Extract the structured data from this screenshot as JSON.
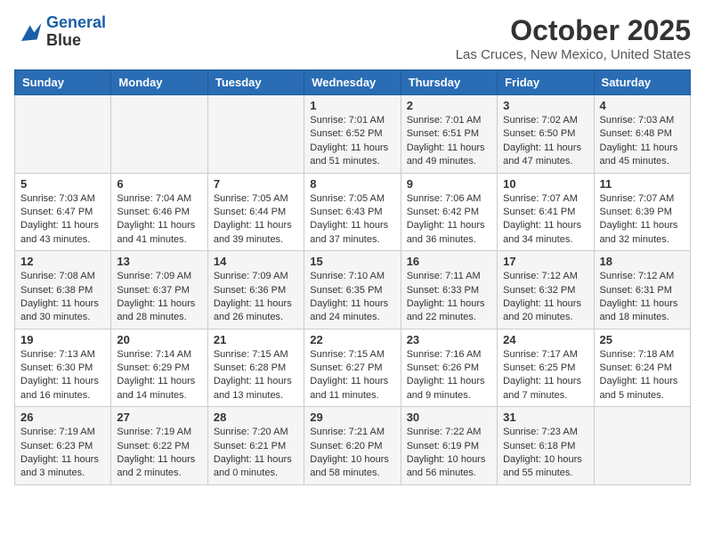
{
  "header": {
    "logo_line1": "General",
    "logo_line2": "Blue",
    "month": "October 2025",
    "location": "Las Cruces, New Mexico, United States"
  },
  "weekdays": [
    "Sunday",
    "Monday",
    "Tuesday",
    "Wednesday",
    "Thursday",
    "Friday",
    "Saturday"
  ],
  "weeks": [
    [
      {
        "day": "",
        "info": ""
      },
      {
        "day": "",
        "info": ""
      },
      {
        "day": "",
        "info": ""
      },
      {
        "day": "1",
        "info": "Sunrise: 7:01 AM\nSunset: 6:52 PM\nDaylight: 11 hours\nand 51 minutes."
      },
      {
        "day": "2",
        "info": "Sunrise: 7:01 AM\nSunset: 6:51 PM\nDaylight: 11 hours\nand 49 minutes."
      },
      {
        "day": "3",
        "info": "Sunrise: 7:02 AM\nSunset: 6:50 PM\nDaylight: 11 hours\nand 47 minutes."
      },
      {
        "day": "4",
        "info": "Sunrise: 7:03 AM\nSunset: 6:48 PM\nDaylight: 11 hours\nand 45 minutes."
      }
    ],
    [
      {
        "day": "5",
        "info": "Sunrise: 7:03 AM\nSunset: 6:47 PM\nDaylight: 11 hours\nand 43 minutes."
      },
      {
        "day": "6",
        "info": "Sunrise: 7:04 AM\nSunset: 6:46 PM\nDaylight: 11 hours\nand 41 minutes."
      },
      {
        "day": "7",
        "info": "Sunrise: 7:05 AM\nSunset: 6:44 PM\nDaylight: 11 hours\nand 39 minutes."
      },
      {
        "day": "8",
        "info": "Sunrise: 7:05 AM\nSunset: 6:43 PM\nDaylight: 11 hours\nand 37 minutes."
      },
      {
        "day": "9",
        "info": "Sunrise: 7:06 AM\nSunset: 6:42 PM\nDaylight: 11 hours\nand 36 minutes."
      },
      {
        "day": "10",
        "info": "Sunrise: 7:07 AM\nSunset: 6:41 PM\nDaylight: 11 hours\nand 34 minutes."
      },
      {
        "day": "11",
        "info": "Sunrise: 7:07 AM\nSunset: 6:39 PM\nDaylight: 11 hours\nand 32 minutes."
      }
    ],
    [
      {
        "day": "12",
        "info": "Sunrise: 7:08 AM\nSunset: 6:38 PM\nDaylight: 11 hours\nand 30 minutes."
      },
      {
        "day": "13",
        "info": "Sunrise: 7:09 AM\nSunset: 6:37 PM\nDaylight: 11 hours\nand 28 minutes."
      },
      {
        "day": "14",
        "info": "Sunrise: 7:09 AM\nSunset: 6:36 PM\nDaylight: 11 hours\nand 26 minutes."
      },
      {
        "day": "15",
        "info": "Sunrise: 7:10 AM\nSunset: 6:35 PM\nDaylight: 11 hours\nand 24 minutes."
      },
      {
        "day": "16",
        "info": "Sunrise: 7:11 AM\nSunset: 6:33 PM\nDaylight: 11 hours\nand 22 minutes."
      },
      {
        "day": "17",
        "info": "Sunrise: 7:12 AM\nSunset: 6:32 PM\nDaylight: 11 hours\nand 20 minutes."
      },
      {
        "day": "18",
        "info": "Sunrise: 7:12 AM\nSunset: 6:31 PM\nDaylight: 11 hours\nand 18 minutes."
      }
    ],
    [
      {
        "day": "19",
        "info": "Sunrise: 7:13 AM\nSunset: 6:30 PM\nDaylight: 11 hours\nand 16 minutes."
      },
      {
        "day": "20",
        "info": "Sunrise: 7:14 AM\nSunset: 6:29 PM\nDaylight: 11 hours\nand 14 minutes."
      },
      {
        "day": "21",
        "info": "Sunrise: 7:15 AM\nSunset: 6:28 PM\nDaylight: 11 hours\nand 13 minutes."
      },
      {
        "day": "22",
        "info": "Sunrise: 7:15 AM\nSunset: 6:27 PM\nDaylight: 11 hours\nand 11 minutes."
      },
      {
        "day": "23",
        "info": "Sunrise: 7:16 AM\nSunset: 6:26 PM\nDaylight: 11 hours\nand 9 minutes."
      },
      {
        "day": "24",
        "info": "Sunrise: 7:17 AM\nSunset: 6:25 PM\nDaylight: 11 hours\nand 7 minutes."
      },
      {
        "day": "25",
        "info": "Sunrise: 7:18 AM\nSunset: 6:24 PM\nDaylight: 11 hours\nand 5 minutes."
      }
    ],
    [
      {
        "day": "26",
        "info": "Sunrise: 7:19 AM\nSunset: 6:23 PM\nDaylight: 11 hours\nand 3 minutes."
      },
      {
        "day": "27",
        "info": "Sunrise: 7:19 AM\nSunset: 6:22 PM\nDaylight: 11 hours\nand 2 minutes."
      },
      {
        "day": "28",
        "info": "Sunrise: 7:20 AM\nSunset: 6:21 PM\nDaylight: 11 hours\nand 0 minutes."
      },
      {
        "day": "29",
        "info": "Sunrise: 7:21 AM\nSunset: 6:20 PM\nDaylight: 10 hours\nand 58 minutes."
      },
      {
        "day": "30",
        "info": "Sunrise: 7:22 AM\nSunset: 6:19 PM\nDaylight: 10 hours\nand 56 minutes."
      },
      {
        "day": "31",
        "info": "Sunrise: 7:23 AM\nSunset: 6:18 PM\nDaylight: 10 hours\nand 55 minutes."
      },
      {
        "day": "",
        "info": ""
      }
    ]
  ]
}
